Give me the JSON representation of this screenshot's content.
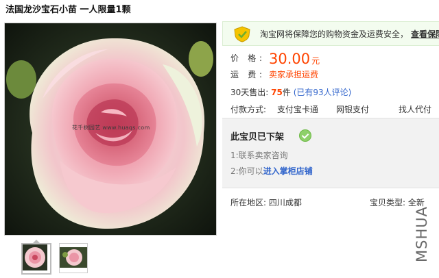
{
  "product": {
    "title": "法国龙沙宝石小苗 一人限量1颗",
    "image_watermark": "花千树园艺 www.huaqs.com"
  },
  "security": {
    "text": "淘宝网将保障您的购物资金及运费安全，",
    "link": "查看保障"
  },
  "price": {
    "label": "价 格:",
    "value": "30.00",
    "unit": "元"
  },
  "shipping": {
    "label": "运 费:",
    "value": "卖家承担运费"
  },
  "sales": {
    "prefix": "30天售出:",
    "count": "75",
    "unit": "件",
    "reviews": "(已有93人评论)"
  },
  "payment": {
    "label": "付款方式:",
    "options": [
      "支付宝卡通",
      "网银支付",
      "找人代付"
    ]
  },
  "offline": {
    "title": "此宝贝已下架",
    "step1": "1:联系卖家咨询",
    "step2_prefix": "2:你可以",
    "step2_link": "进入掌柜店铺"
  },
  "location": {
    "label": "所在地区:",
    "value": "四川成都"
  },
  "category": {
    "label": "宝贝类型:",
    "value": "全新"
  },
  "side_watermark": "MSHUA",
  "colors": {
    "price": "#ff4400",
    "link": "#3366cc",
    "security_bg": "#f3fcef"
  },
  "icons": [
    "shield-icon",
    "check-icon"
  ]
}
